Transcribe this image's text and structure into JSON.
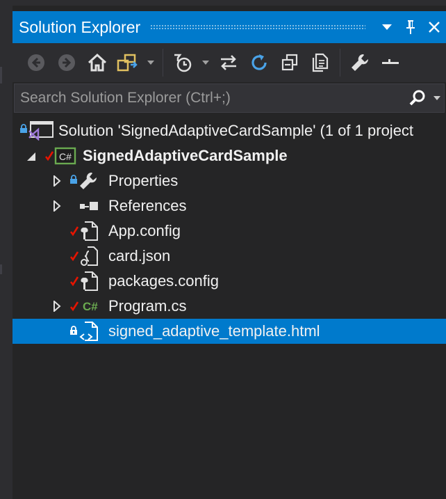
{
  "window": {
    "title": "Solution Explorer",
    "dropdown_icon": "caret-down-icon",
    "pin_icon": "pin-icon",
    "close_icon": "close-icon"
  },
  "toolbar": {
    "buttons": [
      "back-icon",
      "forward-icon",
      "home-icon",
      "switch-views-icon",
      "pending-changes-filter-icon",
      "sync-icon",
      "refresh-icon",
      "collapse-all-icon",
      "show-all-files-icon",
      "properties-icon",
      "preview-icon"
    ]
  },
  "search": {
    "placeholder": "Search Solution Explorer (Ctrl+;)",
    "value": ""
  },
  "tree": {
    "solution": "Solution 'SignedAdaptiveCardSample' (1 of 1 project",
    "project": "SignedAdaptiveCardSample",
    "items": [
      {
        "label": "Properties"
      },
      {
        "label": "References"
      },
      {
        "label": "App.config"
      },
      {
        "label": "card.json"
      },
      {
        "label": "packages.config"
      },
      {
        "label": "Program.cs"
      },
      {
        "label": "signed_adaptive_template.html"
      }
    ]
  },
  "colors": {
    "accent": "#007acc",
    "background": "#252526",
    "checkmark": "#e51400",
    "lock": "#1e90ff",
    "csharp": "#6aaa50",
    "vs_purple": "#9e7ad8"
  }
}
